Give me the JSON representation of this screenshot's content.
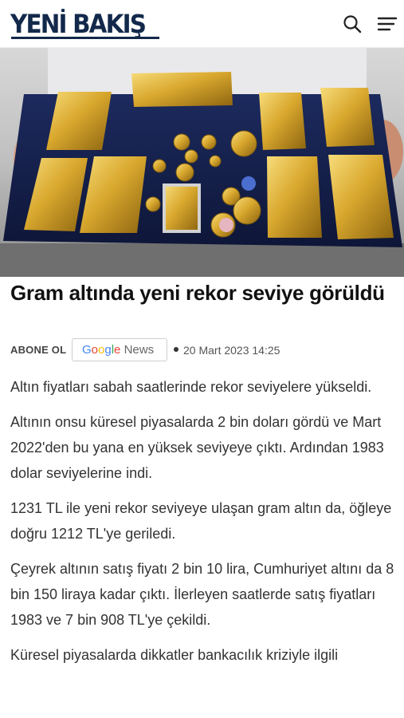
{
  "header": {
    "logo_text": "YENİ BAKIŞ",
    "brand_color": "#13294b",
    "search_icon": "search-icon",
    "menu_icon": "hamburger-menu-icon"
  },
  "hero": {
    "image": "gold bars and coins on a blue display tray"
  },
  "article": {
    "title": "Gram altında yeni rekor seviye görüldü",
    "subscribe_label": "ABONE OL",
    "google_news": {
      "google": "Google",
      "news": "News"
    },
    "date": "20 Mart 2023 14:25",
    "paragraphs": [
      "Altın fiyatları sabah saatlerinde rekor seviyelere yükseldi.",
      "Altının onsu küresel piyasalarda 2 bin doları gördü ve Mart 2022'den bu yana en yüksek seviyeye çıktı. Ardından 1983 dolar seviyelerine indi.",
      "1231 TL ile yeni rekor seviyeye ulaşan gram altın da, öğleye doğru 1212 TL'ye geriledi.",
      "Çeyrek altının satış fiyatı 2 bin 10 lira, Cumhuriyet altını da 8 bin 150 liraya kadar çıktı. İlerleyen saatlerde satış fiyatları 1983 ve 7 bin 908 TL'ye çekildi.",
      "Küresel piyasalarda dikkatler bankacılık kriziyle ilgili"
    ]
  }
}
